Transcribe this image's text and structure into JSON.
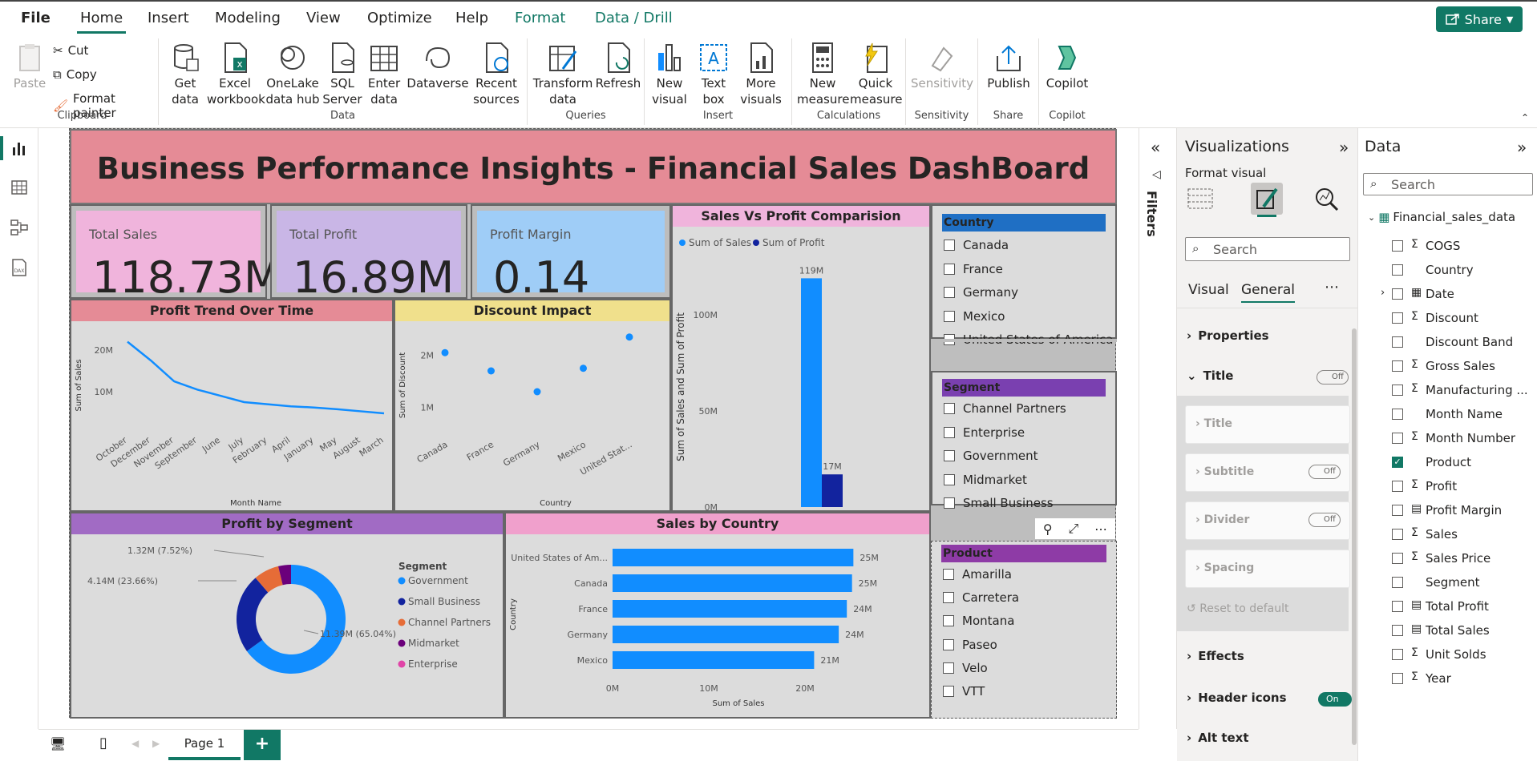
{
  "menu": {
    "file": "File",
    "tabs": [
      "Home",
      "Insert",
      "Modeling",
      "View",
      "Optimize",
      "Help",
      "Format",
      "Data / Drill"
    ],
    "active": "Home",
    "share": "Share"
  },
  "ribbon": {
    "clipboard": {
      "paste": "Paste",
      "cut": "Cut",
      "copy": "Copy",
      "format_painter": "Format painter",
      "label": "Clipboard"
    },
    "data": {
      "get_data": [
        "Get",
        "data"
      ],
      "excel": [
        "Excel",
        "workbook"
      ],
      "onelake": [
        "OneLake",
        "data hub"
      ],
      "sql": [
        "SQL",
        "Server"
      ],
      "enter": [
        "Enter",
        "data"
      ],
      "dataverse": [
        "Dataverse",
        ""
      ],
      "recent": [
        "Recent",
        "sources"
      ],
      "label": "Data"
    },
    "queries": {
      "transform": [
        "Transform",
        "data"
      ],
      "refresh": [
        "Refresh",
        ""
      ],
      "label": "Queries"
    },
    "insert": {
      "new_visual": [
        "New",
        "visual"
      ],
      "text_box": [
        "Text",
        "box"
      ],
      "more": [
        "More",
        "visuals"
      ],
      "label": "Insert"
    },
    "calculations": {
      "new_measure": [
        "New",
        "measure"
      ],
      "quick_measure": [
        "Quick",
        "measure"
      ],
      "label": "Calculations"
    },
    "sensitivity": {
      "btn": "Sensitivity",
      "label": "Sensitivity"
    },
    "share": {
      "publish": "Publish",
      "label": "Share"
    },
    "copilot": {
      "btn": "Copilot",
      "label": "Copilot"
    }
  },
  "report": {
    "title": "Business Performance Insights - Financial Sales DashBoard",
    "kpis": [
      {
        "label": "Total Sales",
        "value": "118.73M",
        "bg": "#f0b4dc"
      },
      {
        "label": "Total Profit",
        "value": "16.89M",
        "bg": "#c9b6e6"
      },
      {
        "label": "Profit Margin",
        "value": "0.14",
        "bg": "#9fcdf7"
      }
    ],
    "profit_trend": {
      "title": "Profit Trend Over Time",
      "ylabel": "Sum of Sales",
      "xlabel": "Month Name",
      "yticks": [
        "20M",
        "10M"
      ]
    },
    "discount": {
      "title": "Discount Impact",
      "ylabel": "Sum of Discount",
      "xlabel": "Country",
      "yticks": [
        "2M",
        "1M"
      ]
    },
    "sales_profit": {
      "title": "Sales Vs Profit Comparision",
      "legend": [
        "Sum of Sales",
        "Sum of Profit"
      ],
      "ylabel": "Sum of Sales and Sum of Profit",
      "yticks": [
        "100M",
        "50M",
        "0M"
      ],
      "labels": [
        "119M",
        "17M"
      ]
    },
    "segment": {
      "title": "Profit by Segment",
      "legend_title": "Segment",
      "labels": [
        "11.39M (65.04%)",
        "4.14M (23.66%)",
        "1.32M (7.52%)"
      ]
    },
    "country": {
      "title": "Sales by Country",
      "ylabel": "Country",
      "xlabel": "Sum of Sales",
      "xticks": [
        "0M",
        "10M",
        "20M"
      ]
    },
    "slicers": {
      "country": {
        "title": "Country",
        "items": [
          "Canada",
          "France",
          "Germany",
          "Mexico",
          "United States of America"
        ]
      },
      "segment": {
        "title": "Segment",
        "items": [
          "Channel Partners",
          "Enterprise",
          "Government",
          "Midmarket",
          "Small Business"
        ]
      },
      "product": {
        "title": "Product",
        "items": [
          "Amarilla",
          "Carretera",
          "Montana",
          "Paseo",
          "Velo",
          "VTT"
        ]
      }
    }
  },
  "chart_data": [
    {
      "type": "line",
      "title": "Profit Trend Over Time",
      "xlabel": "Month Name",
      "ylabel": "Sum of Sales",
      "categories": [
        "October",
        "December",
        "November",
        "September",
        "June",
        "July",
        "February",
        "April",
        "January",
        "May",
        "August",
        "March"
      ],
      "values": [
        22,
        17.5,
        12.5,
        10.5,
        9,
        7.5,
        7,
        6.5,
        6.2,
        5.8,
        5.3,
        4.8
      ],
      "unit": "M"
    },
    {
      "type": "scatter",
      "title": "Discount Impact",
      "xlabel": "Country",
      "ylabel": "Sum of Discount",
      "categories": [
        "Canada",
        "France",
        "Germany",
        "Mexico",
        "United States of America"
      ],
      "values": [
        2.05,
        1.7,
        1.3,
        1.75,
        2.35
      ],
      "unit": "M"
    },
    {
      "type": "bar",
      "title": "Sales Vs Profit Comparision",
      "series": [
        {
          "name": "Sum of Sales",
          "values": [
            119
          ],
          "color": "#118dff"
        },
        {
          "name": "Sum of Profit",
          "values": [
            17
          ],
          "color": "#12239e"
        }
      ],
      "unit": "M",
      "ylim": [
        0,
        125
      ]
    },
    {
      "type": "pie",
      "title": "Profit by Segment",
      "slices": [
        {
          "name": "Government",
          "value": 11.39,
          "pct": 65.04,
          "color": "#118dff"
        },
        {
          "name": "Small Business",
          "value": 4.14,
          "pct": 23.66,
          "color": "#12239e"
        },
        {
          "name": "Channel Partners",
          "value": 1.32,
          "pct": 7.52,
          "color": "#e66c37"
        },
        {
          "name": "Midmarket",
          "value": 0.66,
          "pct": 3.78,
          "color": "#6b007b"
        },
        {
          "name": "Enterprise",
          "value": 0.0,
          "pct": 0.0,
          "color": "#e044a7"
        }
      ]
    },
    {
      "type": "bar",
      "orientation": "horizontal",
      "title": "Sales by Country",
      "xlabel": "Sum of Sales",
      "ylabel": "Country",
      "categories": [
        "United States of Am...",
        "Canada",
        "France",
        "Germany",
        "Mexico"
      ],
      "values": [
        25.03,
        24.89,
        24.35,
        23.51,
        20.95
      ],
      "labels": [
        "25M",
        "25M",
        "24M",
        "24M",
        "21M"
      ],
      "unit": "M",
      "xlim": [
        0,
        30
      ]
    }
  ],
  "filters": {
    "label": "Filters"
  },
  "visualizations": {
    "title": "Visualizations",
    "subtitle": "Format visual",
    "search": "Search",
    "tabs": [
      "Visual",
      "General"
    ],
    "sections": {
      "properties": "Properties",
      "title": "Title",
      "title_sub": "Title",
      "subtitle": "Subtitle",
      "divider": "Divider",
      "spacing": "Spacing",
      "reset": "Reset to default",
      "effects": "Effects",
      "header_icons": "Header icons",
      "alt_text": "Alt text"
    },
    "off": "Off",
    "on": "On"
  },
  "data_pane": {
    "title": "Data",
    "search": "Search",
    "table": "Financial_sales_data",
    "fields": [
      {
        "name": "COGS",
        "type": "sigma",
        "checked": false
      },
      {
        "name": "Country",
        "type": "text",
        "checked": false
      },
      {
        "name": "Date",
        "type": "calendar",
        "checked": false
      },
      {
        "name": "Discount",
        "type": "sigma",
        "checked": false
      },
      {
        "name": "Discount Band",
        "type": "text",
        "checked": false
      },
      {
        "name": "Gross Sales",
        "type": "sigma",
        "checked": false
      },
      {
        "name": "Manufacturing ...",
        "type": "sigma",
        "checked": false
      },
      {
        "name": "Month Name",
        "type": "text",
        "checked": false
      },
      {
        "name": "Month Number",
        "type": "sigma",
        "checked": false
      },
      {
        "name": "Product",
        "type": "text",
        "checked": true
      },
      {
        "name": "Profit",
        "type": "sigma",
        "checked": false
      },
      {
        "name": "Profit Margin",
        "type": "calc",
        "checked": false
      },
      {
        "name": "Sales",
        "type": "sigma",
        "checked": false
      },
      {
        "name": "Sales Price",
        "type": "sigma",
        "checked": false
      },
      {
        "name": "Segment",
        "type": "text",
        "checked": false
      },
      {
        "name": "Total Profit",
        "type": "calc",
        "checked": false
      },
      {
        "name": "Total Sales",
        "type": "calc",
        "checked": false
      },
      {
        "name": "Unit Solds",
        "type": "sigma",
        "checked": false
      },
      {
        "name": "Year",
        "type": "sigma",
        "checked": false
      }
    ]
  },
  "status": {
    "page": "Page 1",
    "add": "+"
  }
}
